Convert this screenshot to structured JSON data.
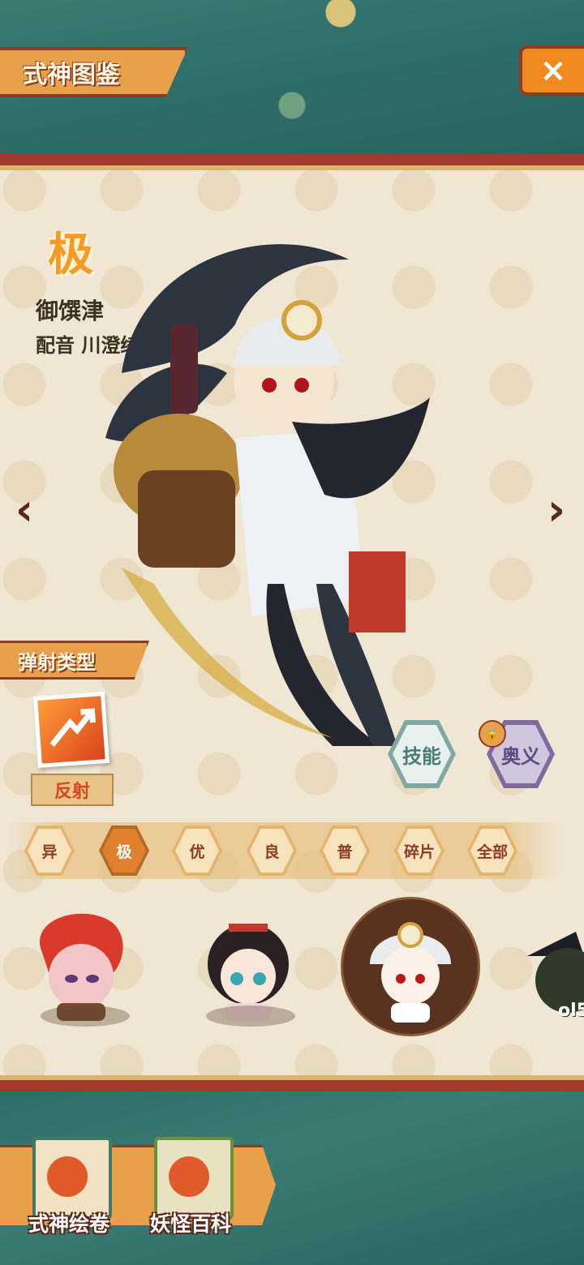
{
  "header": {
    "title": "式神图鉴",
    "close_icon": "×"
  },
  "character": {
    "rarity": "极",
    "name": "御馔津",
    "voice": "配音 川澄绫子"
  },
  "navigation": {
    "prev_icon": "‹",
    "next_icon": "›"
  },
  "bounce_type": {
    "heading": "弹射类型",
    "value": "反射"
  },
  "buttons": {
    "skill": "技能",
    "mystery": "奥义",
    "lock_icon": "🔒"
  },
  "filters": [
    "异",
    "极",
    "优",
    "良",
    "普",
    "碎片",
    "全部"
  ],
  "selected_filter": "极",
  "roster": {
    "partial_label": "ol5"
  },
  "bottom_menu": {
    "scroll": "式神绘卷",
    "encyclopedia": "妖怪百科"
  },
  "colors": {
    "accent_orange": "#e8a04a",
    "panel_border": "#a13a2b",
    "teal": "#2f6d68"
  }
}
